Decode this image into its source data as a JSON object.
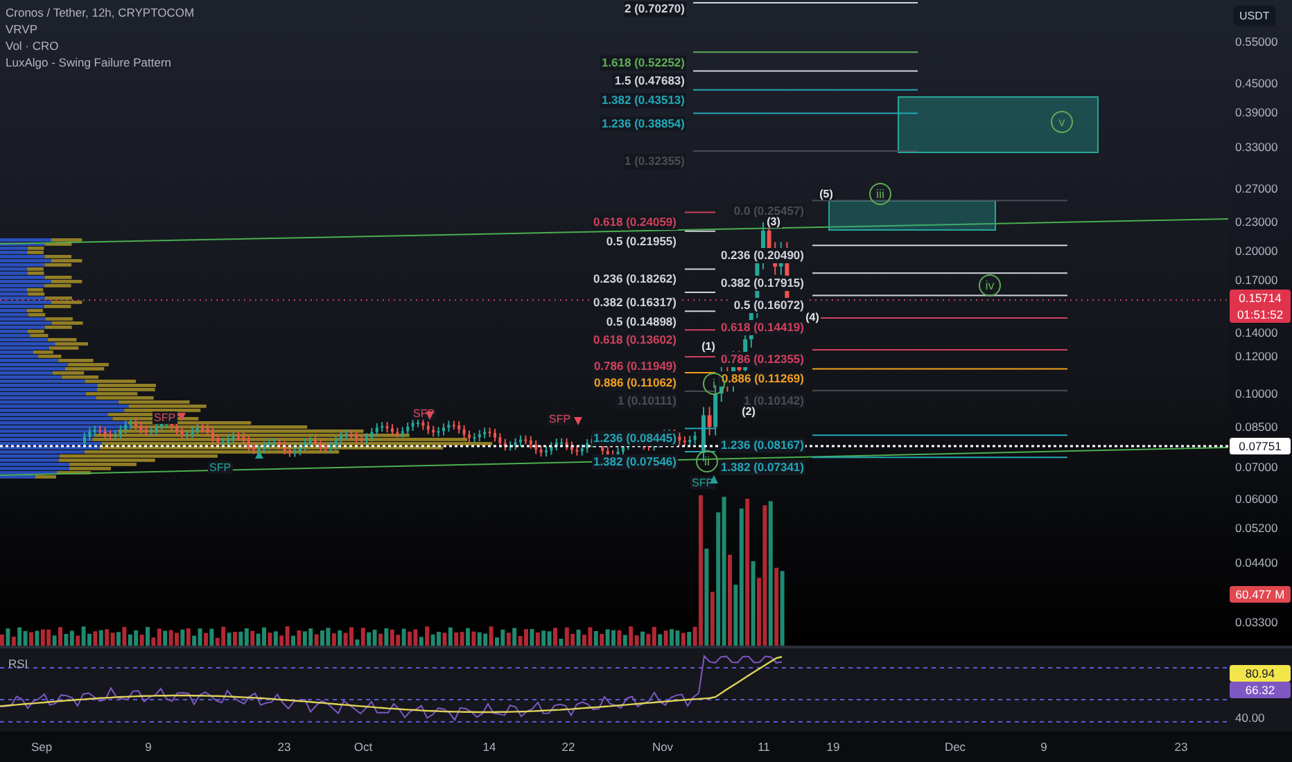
{
  "legend": [
    "Cronos / Tether, 12h, CRYPTOCOM",
    "VRVP",
    "Vol · CRO",
    "LuxAlgo - Swing Failure Pattern"
  ],
  "price_axis": {
    "currency": "USDT",
    "ticks": [
      "0.55000",
      "0.45000",
      "0.39000",
      "0.33000",
      "0.27000",
      "0.23000",
      "0.20000",
      "0.17000",
      "0.14000",
      "0.12000",
      "0.10000",
      "0.08500",
      "0.07000",
      "0.06000",
      "0.05200",
      "0.04400",
      "0.03300"
    ],
    "last_price": "0.15714",
    "countdown": "01:51:52",
    "crosshair_price": "0.07751",
    "volume_value": "60.477 M"
  },
  "fib_left": [
    {
      "label": "2 (0.70270)",
      "color": "#d1d4dc"
    },
    {
      "label": "1.618 (0.52252)",
      "color": "#5fae55"
    },
    {
      "label": "1.5 (0.47683)",
      "color": "#d1d4dc"
    },
    {
      "label": "1.382 (0.43513)",
      "color": "#22a7b8"
    },
    {
      "label": "1.236 (0.38854)",
      "color": "#22a7b8"
    },
    {
      "label": "1 (0.32355)",
      "color": "#4a4d56"
    },
    {
      "label": "0.618 (0.24059)",
      "color": "#d0415e"
    },
    {
      "label": "0.5 (0.21955)",
      "color": "#d1d4dc"
    },
    {
      "label": "0.236 (0.18262)",
      "color": "#d1d4dc"
    },
    {
      "label": "0.382 (0.16317)",
      "color": "#d1d4dc"
    },
    {
      "label": "0.5 (0.14898)",
      "color": "#d1d4dc"
    },
    {
      "label": "0.618 (0.13602)",
      "color": "#d0415e"
    },
    {
      "label": "0.786 (0.11949)",
      "color": "#d0415e"
    },
    {
      "label": "0.886 (0.11062)",
      "color": "#f0a020"
    },
    {
      "label": "1 (0.10111)",
      "color": "#4a4d56"
    },
    {
      "label": "1.236 (0.08445)",
      "color": "#22a7b8"
    },
    {
      "label": "1.382 (0.07546)",
      "color": "#22a7b8"
    }
  ],
  "fib_right": [
    {
      "label": "0.0 (0.25457)",
      "color": "#4a4d56"
    },
    {
      "label": "0.236 (0.20490)",
      "color": "#d1d4dc"
    },
    {
      "label": "0.382 (0.17915)",
      "color": "#d1d4dc"
    },
    {
      "label": "0.5 (0.16072)",
      "color": "#d1d4dc"
    },
    {
      "label": "0.618 (0.14419)",
      "color": "#d0415e"
    },
    {
      "label": "0.786 (0.12355)",
      "color": "#d0415e"
    },
    {
      "label": "0.886 (0.11269)",
      "color": "#f0a020"
    },
    {
      "label": "1 (0.10142)",
      "color": "#4a4d56"
    },
    {
      "label": "1.236 (0.08167)",
      "color": "#22a7b8"
    },
    {
      "label": "1.382 (0.07341)",
      "color": "#22a7b8"
    }
  ],
  "wave_labels": [
    {
      "text": "(5)",
      "kind": "numbered"
    },
    {
      "text": "(3)",
      "kind": "numbered"
    },
    {
      "text": "(4)",
      "kind": "numbered"
    },
    {
      "text": "(1)",
      "kind": "numbered"
    },
    {
      "text": "(2)",
      "kind": "numbered"
    },
    {
      "text": "iii",
      "kind": "circled"
    },
    {
      "text": "v",
      "kind": "circled"
    },
    {
      "text": "iv",
      "kind": "circled"
    },
    {
      "text": "i",
      "kind": "circled"
    },
    {
      "text": "ii",
      "kind": "circled"
    }
  ],
  "sfp_markers": [
    {
      "text": "SFP",
      "kind": "bearish"
    },
    {
      "text": "SFP",
      "kind": "bearish"
    },
    {
      "text": "SFP",
      "kind": "bearish"
    },
    {
      "text": "SFP",
      "kind": "bullish"
    },
    {
      "text": "SFP",
      "kind": "bullish"
    }
  ],
  "rsi": {
    "title": "RSI",
    "value": "80.94",
    "average": "66.32",
    "tick": "40.00"
  },
  "time_axis": [
    "Sep",
    "9",
    "23",
    "Oct",
    "14",
    "22",
    "Nov",
    "11",
    "19",
    "Dec",
    "9",
    "23"
  ]
}
